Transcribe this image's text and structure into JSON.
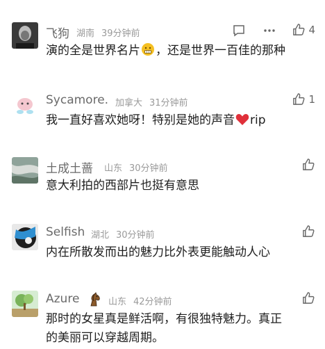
{
  "comments": [
    {
      "name": "飞狗",
      "location": "湖南",
      "time": "39分钟前",
      "text_before": "演的全是世界名片",
      "emoji": "grimace-emoji",
      "text_after": "，还是世界一百佳的那种",
      "likes": "4",
      "show_actions": true
    },
    {
      "name": "Sycamore.",
      "location": "加拿大",
      "time": "31分钟前",
      "text_before": "我一直好喜欢她呀！特别是她的声音",
      "emoji": "heart-emoji",
      "text_after": "rip",
      "likes": "1"
    },
    {
      "name": "土成土蔷",
      "location": "山东",
      "time": "30分钟前",
      "text": "意大利拍的西部片也挺有意思"
    },
    {
      "name": "Selfish",
      "location": "湖北",
      "time": "30分钟前",
      "text": "内在所散发而出的魅力比外表更能触动人心"
    },
    {
      "name": "Azure",
      "location": "山东",
      "time": "42分钟前",
      "text_line1": "那时的女星真是鲜活啊，有很独特魅力。真正",
      "text_line2": "的美丽可以穿越周期。"
    }
  ],
  "colors": {
    "name": "#6a6a6a",
    "meta": "#9a9a9a",
    "heart": "#e0303a"
  }
}
